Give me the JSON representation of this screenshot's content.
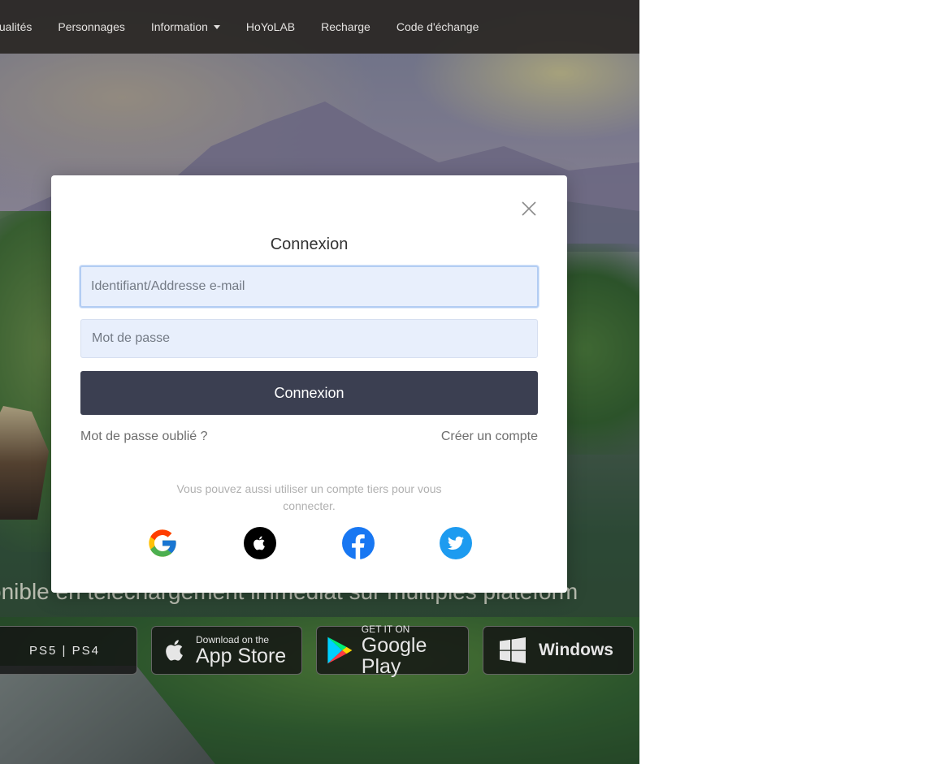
{
  "nav": {
    "items": [
      {
        "label": "ctualités"
      },
      {
        "label": "Personnages"
      },
      {
        "label": "Information"
      },
      {
        "label": "HoYoLAB"
      },
      {
        "label": "Recharge"
      },
      {
        "label": "Code d'échange"
      }
    ]
  },
  "hero": {
    "tagline": "onible en téléchargement immédiat sur multiples plateform",
    "stores": {
      "playstation": "PS5 | PS4",
      "apple_small": "Download on the",
      "apple_big": "App Store",
      "google_small": "GET IT ON",
      "google_big": "Google Play",
      "windows": "Windows"
    }
  },
  "login_modal": {
    "title": "Connexion",
    "username_placeholder": "Identifiant/Addresse e-mail",
    "username_value": "",
    "password_placeholder": "Mot de passe",
    "password_value": "",
    "submit_label": "Connexion",
    "forgot_password": "Mot de passe oublié ?",
    "create_account": "Créer un compte",
    "third_party_text": "Vous pouvez aussi utiliser un compte tiers pour vous connecter.",
    "social_icons": [
      "google-icon",
      "apple-icon",
      "facebook-icon",
      "twitter-icon"
    ]
  },
  "colors": {
    "login_button": "#3b3f51",
    "input_background": "#e8effc",
    "navbar": "#2d2a28",
    "facebook": "#1877f2",
    "twitter": "#1d9bf0"
  }
}
